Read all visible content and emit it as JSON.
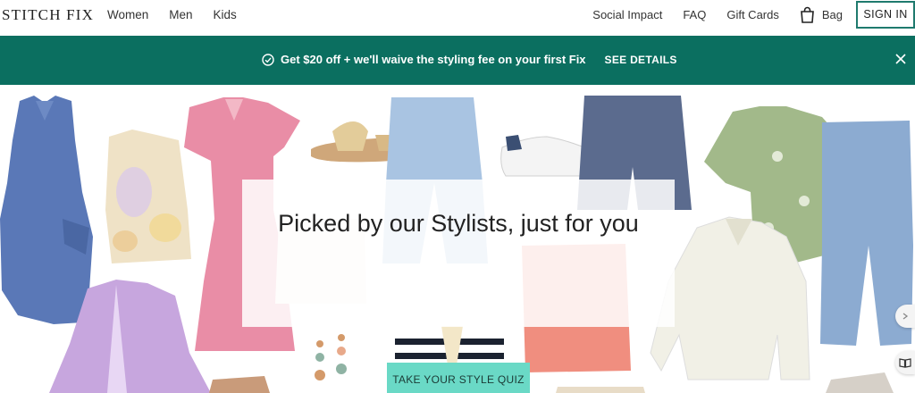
{
  "brand": {
    "logo": "STITCH FIX"
  },
  "nav_left": [
    "Women",
    "Men",
    "Kids"
  ],
  "nav_right": {
    "social_impact": "Social Impact",
    "faq": "FAQ",
    "gift_cards": "Gift Cards",
    "bag": "Bag",
    "sign_in": "SIGN IN"
  },
  "promo": {
    "text": "Get $20 off + we'll waive the styling fee on your first Fix",
    "link": "SEE DETAILS",
    "background": "#0b6f60"
  },
  "hero": {
    "title": "Picked by our Stylists, just for you",
    "cta": "TAKE YOUR STYLE QUIZ",
    "cta_color": "#6ad9c6"
  },
  "icons": [
    "check-circle-icon",
    "close-icon",
    "bag-icon",
    "book-icon"
  ]
}
